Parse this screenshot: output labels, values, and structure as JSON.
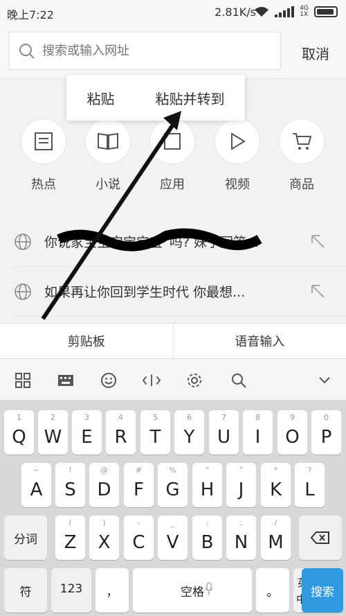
{
  "status": {
    "time": "晚上7:22",
    "speed": "2.81K/s",
    "network_top": "4G",
    "network_bottom": "1X"
  },
  "search": {
    "placeholder": "搜索或输入网址",
    "cancel_label": "取消"
  },
  "popup": {
    "paste_label": "粘贴",
    "paste_go_label": "粘贴并转到"
  },
  "shortcuts": [
    {
      "label": "热点",
      "icon": "hot-news-icon"
    },
    {
      "label": "小说",
      "icon": "book-icon"
    },
    {
      "label": "应用",
      "icon": "app-icon"
    },
    {
      "label": "视频",
      "icon": "video-icon"
    },
    {
      "label": "商品",
      "icon": "cart-icon"
    }
  ],
  "history": [
    {
      "text": "你说家宝宝宝宝宝宝”吗? 妹子回答..."
    },
    {
      "text": "如果再让你回到学生时代 你最想..."
    }
  ],
  "clip_bar": {
    "clipboard_label": "剪贴板",
    "voice_label": "语音输入"
  },
  "keyboard": {
    "row1": [
      {
        "main": "Q",
        "sub": "1"
      },
      {
        "main": "W",
        "sub": "2"
      },
      {
        "main": "E",
        "sub": "3"
      },
      {
        "main": "R",
        "sub": "4"
      },
      {
        "main": "T",
        "sub": "5"
      },
      {
        "main": "Y",
        "sub": "6"
      },
      {
        "main": "U",
        "sub": "7"
      },
      {
        "main": "I",
        "sub": "8"
      },
      {
        "main": "O",
        "sub": "9"
      },
      {
        "main": "P",
        "sub": "0"
      }
    ],
    "row2": [
      {
        "main": "A",
        "sub": "~"
      },
      {
        "main": "S",
        "sub": "!"
      },
      {
        "main": "D",
        "sub": "@"
      },
      {
        "main": "F",
        "sub": "#"
      },
      {
        "main": "G",
        "sub": "%"
      },
      {
        "main": "H",
        "sub": "“"
      },
      {
        "main": "J",
        "sub": "”"
      },
      {
        "main": "K",
        "sub": "*"
      },
      {
        "main": "L",
        "sub": "?"
      }
    ],
    "row3": [
      {
        "main": "Z",
        "sub": "("
      },
      {
        "main": "X",
        "sub": ")"
      },
      {
        "main": "C",
        "sub": "-"
      },
      {
        "main": "V",
        "sub": "_"
      },
      {
        "main": "B",
        "sub": ":"
      },
      {
        "main": "N",
        "sub": ";"
      },
      {
        "main": "M",
        "sub": "/"
      }
    ],
    "split_label": "分词",
    "symbol_label": "符",
    "num_label": "123",
    "comma_label": "，",
    "space_label": "空格",
    "period_label": "。",
    "lang_top": "英",
    "lang_bottom": "中",
    "search_label": "搜索"
  }
}
